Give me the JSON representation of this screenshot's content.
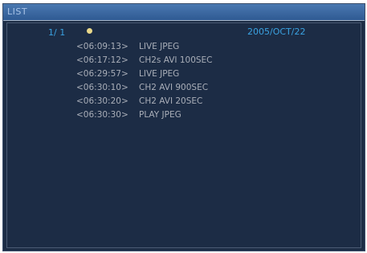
{
  "window": {
    "title": "LIST",
    "page": "1/ 1",
    "date": "2005/OCT/22"
  },
  "entries": [
    {
      "time": "<06:09:13>",
      "desc": "LIVE JPEG"
    },
    {
      "time": "<06:17:12>",
      "desc": "CH2s AVI 100SEC"
    },
    {
      "time": "<06:29:57>",
      "desc": "LIVE JPEG"
    },
    {
      "time": "<06:30:10>",
      "desc": "CH2 AVI 900SEC"
    },
    {
      "time": "<06:30:20>",
      "desc": "CH2 AVI 20SEC"
    },
    {
      "time": "<06:30:30>",
      "desc": "PLAY JPEG"
    }
  ]
}
